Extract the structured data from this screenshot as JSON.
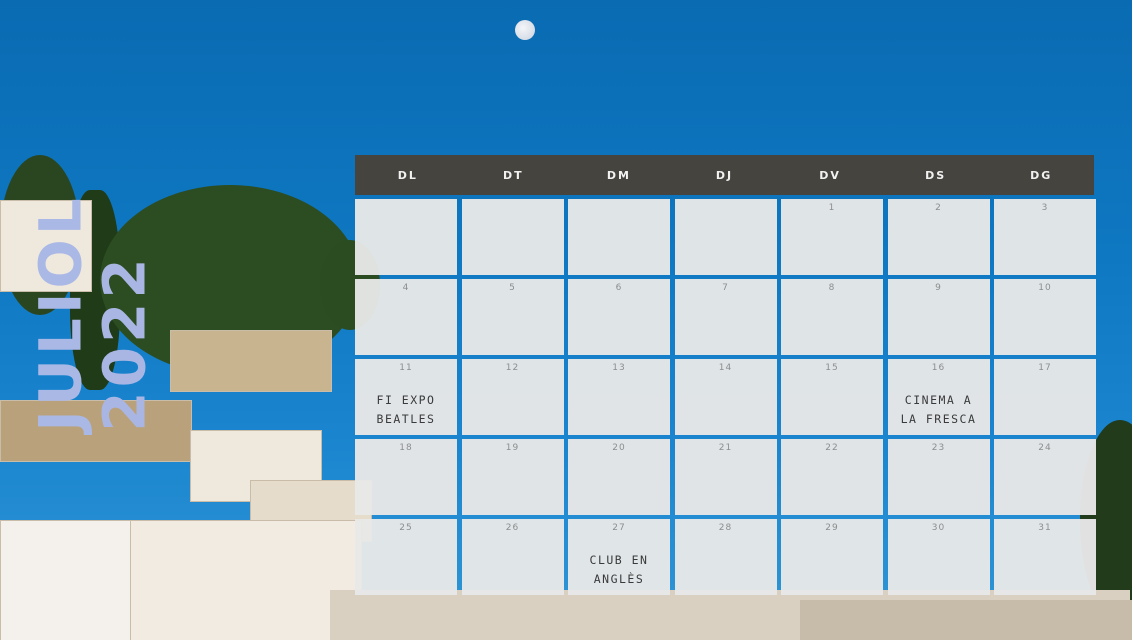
{
  "title": {
    "month": "JULIOL",
    "year": "2022",
    "color": "#aab8e6"
  },
  "calendar": {
    "header_bg": "#45443f",
    "cell_bg": "#e8e8e8",
    "weekdays": [
      "DL",
      "DT",
      "DM",
      "DJ",
      "DV",
      "DS",
      "DG"
    ],
    "weeks": [
      [
        {
          "day": "",
          "event": ""
        },
        {
          "day": "",
          "event": ""
        },
        {
          "day": "",
          "event": ""
        },
        {
          "day": "",
          "event": ""
        },
        {
          "day": "1",
          "event": ""
        },
        {
          "day": "2",
          "event": ""
        },
        {
          "day": "3",
          "event": ""
        }
      ],
      [
        {
          "day": "4",
          "event": ""
        },
        {
          "day": "5",
          "event": ""
        },
        {
          "day": "6",
          "event": ""
        },
        {
          "day": "7",
          "event": ""
        },
        {
          "day": "8",
          "event": ""
        },
        {
          "day": "9",
          "event": ""
        },
        {
          "day": "10",
          "event": ""
        }
      ],
      [
        {
          "day": "11",
          "event": "FI EXPO\nBEATLES"
        },
        {
          "day": "12",
          "event": ""
        },
        {
          "day": "13",
          "event": ""
        },
        {
          "day": "14",
          "event": ""
        },
        {
          "day": "15",
          "event": ""
        },
        {
          "day": "16",
          "event": "CINEMA A\nLA FRESCA"
        },
        {
          "day": "17",
          "event": ""
        }
      ],
      [
        {
          "day": "18",
          "event": ""
        },
        {
          "day": "19",
          "event": ""
        },
        {
          "day": "20",
          "event": ""
        },
        {
          "day": "21",
          "event": ""
        },
        {
          "day": "22",
          "event": ""
        },
        {
          "day": "23",
          "event": ""
        },
        {
          "day": "24",
          "event": ""
        }
      ],
      [
        {
          "day": "25",
          "event": ""
        },
        {
          "day": "26",
          "event": ""
        },
        {
          "day": "27",
          "event": "CLUB EN\nANGLÈS"
        },
        {
          "day": "28",
          "event": ""
        },
        {
          "day": "29",
          "event": ""
        },
        {
          "day": "30",
          "event": ""
        },
        {
          "day": "31",
          "event": ""
        }
      ]
    ]
  },
  "background": {
    "moon_icon": "moon-icon",
    "sky_color": "#0e78c2"
  }
}
